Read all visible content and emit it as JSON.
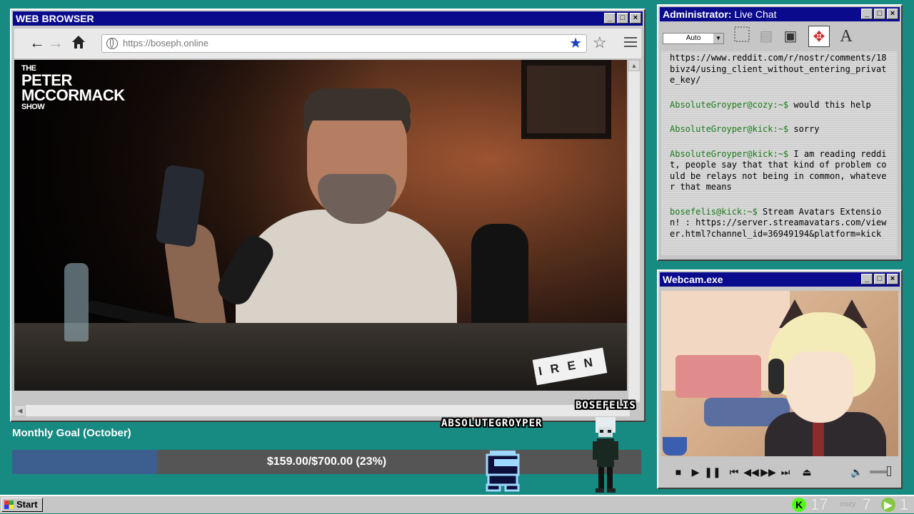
{
  "browser": {
    "title": "WEB BROWSER",
    "url": "https://boseph.online",
    "window_controls": [
      "_",
      "□",
      "×"
    ],
    "video": {
      "show_logo_line1": "THE",
      "show_logo_line2": "PETER",
      "show_logo_line3": "MCCORMACK",
      "show_logo_line4": "SHOW",
      "sponsor_sign": "IREN"
    }
  },
  "chat": {
    "title_prefix": "Administrator:",
    "title_suffix": " Live Chat",
    "font_select": "Auto",
    "messages": [
      {
        "user": "",
        "text": "https://www.reddit.com/r/nostr/comments/18bivz4/using_client_without_entering_private_key/"
      },
      {
        "user": "AbsoluteGroyper@cozy:~$",
        "text": " would this help"
      },
      {
        "user": "AbsoluteGroyper@kick:~$",
        "text": " sorry"
      },
      {
        "user": "AbsoluteGroyper@kick:~$",
        "text": " I am reading reddit, people say that that kind of problem could be relays not being in common, whatever that means"
      },
      {
        "user": "bosefelis@kick:~$",
        "text": " Stream Avatars Extension! : https://server.streamavatars.com/viewer.html?channel_id=36949194&platform=kick"
      }
    ]
  },
  "webcam": {
    "title": "Webcam.exe"
  },
  "goal": {
    "title": "Monthly Goal (October)",
    "progress_text": "$159.00/$700.00 (23%)",
    "progress_fraction": 0.23
  },
  "avatars": {
    "name_a": "ABSOLUTEGROYPER",
    "name_b": "BOSEFELIS"
  },
  "taskbar": {
    "start_label": "Start",
    "tray": [
      {
        "icon": "kick-icon",
        "value": "17",
        "color": "#53fc18"
      },
      {
        "icon": "cozy-icon",
        "value": "7",
        "color": "#d0d0d0"
      },
      {
        "icon": "rumble-icon",
        "value": "1",
        "color": "#85c742"
      }
    ]
  }
}
